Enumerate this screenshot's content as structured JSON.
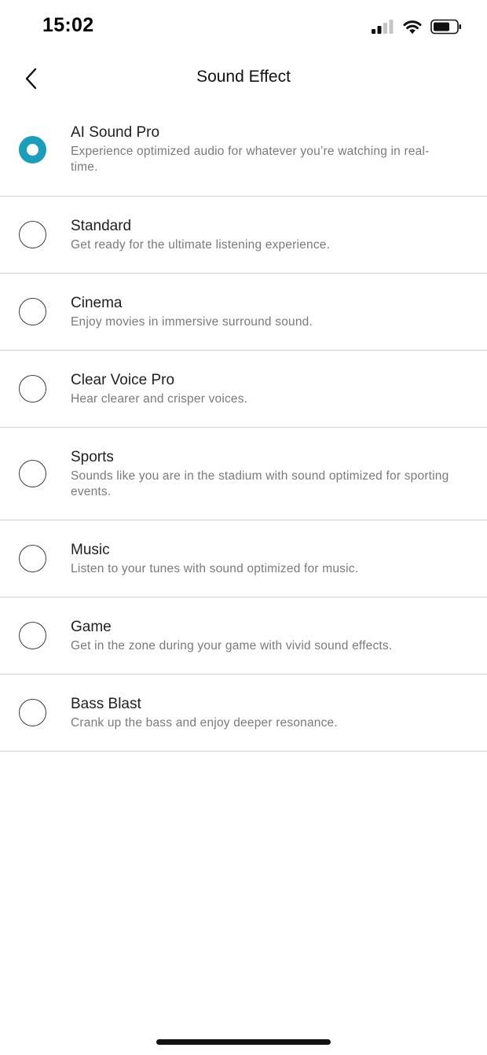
{
  "status_bar": {
    "time": "15:02",
    "icons": [
      "signal-icon",
      "wifi-icon",
      "battery-icon"
    ]
  },
  "header": {
    "title": "Sound Effect",
    "back_icon": "chevron-left-icon"
  },
  "accent_color": "#1a9fba",
  "options": [
    {
      "title": "AI Sound Pro",
      "description": "Experience optimized audio for whatever you’re watching in real-time.",
      "selected": true
    },
    {
      "title": "Standard",
      "description": "Get ready for the ultimate listening experience.",
      "selected": false
    },
    {
      "title": "Cinema",
      "description": "Enjoy movies in immersive surround sound.",
      "selected": false
    },
    {
      "title": "Clear Voice Pro",
      "description": "Hear clearer and crisper voices.",
      "selected": false
    },
    {
      "title": "Sports",
      "description": "Sounds like you are in the stadium with sound optimized for sporting events.",
      "selected": false
    },
    {
      "title": "Music",
      "description": "Listen to your tunes with sound optimized for music.",
      "selected": false
    },
    {
      "title": "Game",
      "description": "Get in the zone during your game with vivid sound effects.",
      "selected": false
    },
    {
      "title": "Bass Blast",
      "description": "Crank up the bass and enjoy deeper resonance.",
      "selected": false
    }
  ]
}
